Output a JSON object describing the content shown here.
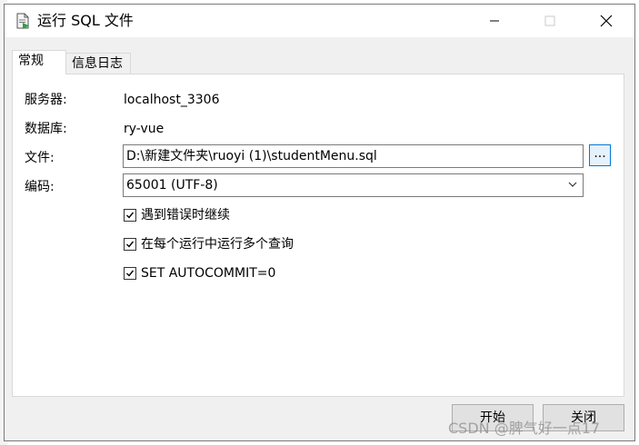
{
  "window": {
    "title": "运行 SQL 文件"
  },
  "tabs": [
    {
      "label": "常规",
      "active": true
    },
    {
      "label": "信息日志",
      "active": false
    }
  ],
  "form": {
    "server_label": "服务器:",
    "server_value": "localhost_3306",
    "database_label": "数据库:",
    "database_value": "ry-vue",
    "file_label": "文件:",
    "file_value": "D:\\新建文件夹\\ruoyi (1)\\studentMenu.sql",
    "browse_label": "...",
    "encoding_label": "编码:",
    "encoding_value": "65001 (UTF-8)"
  },
  "options": [
    {
      "label": "遇到错误时继续",
      "checked": true
    },
    {
      "label": "在每个运行中运行多个查询",
      "checked": true
    },
    {
      "label": "SET AUTOCOMMIT=0",
      "checked": true
    }
  ],
  "buttons": {
    "start": "开始",
    "close": "关闭"
  },
  "watermark": "CSDN @脾气好一点17",
  "colors": {
    "accent": "#0078d7",
    "window_bg": "#f0f0f0",
    "panel_bg": "#ffffff"
  },
  "icons": {
    "app": "sql-file-run-icon",
    "minimize": "minimize-icon",
    "maximize": "maximize-icon",
    "close": "close-icon",
    "dropdown": "chevron-down-icon",
    "check": "check-icon"
  }
}
